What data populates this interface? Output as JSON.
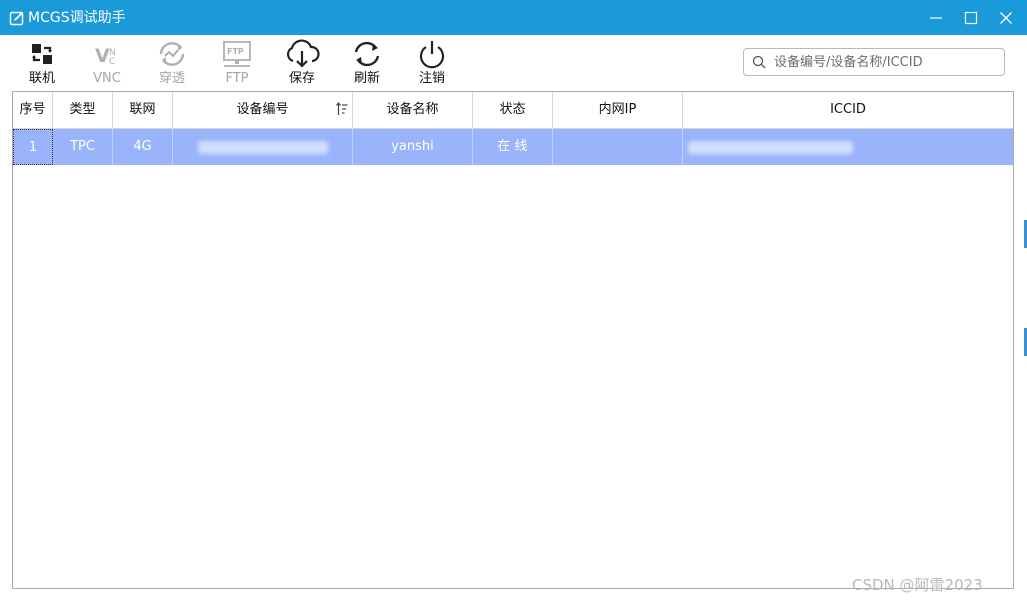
{
  "window": {
    "title": "MCGS调试助手"
  },
  "toolbar": {
    "items": [
      {
        "label": "联机",
        "icon": "link-icon",
        "enabled": true
      },
      {
        "label": "VNC",
        "icon": "vnc-icon",
        "enabled": false
      },
      {
        "label": "穿透",
        "icon": "penetrate-icon",
        "enabled": false
      },
      {
        "label": "FTP",
        "icon": "ftp-icon",
        "enabled": false
      },
      {
        "label": "保存",
        "icon": "cloud-download-icon",
        "enabled": true
      },
      {
        "label": "刷新",
        "icon": "refresh-icon",
        "enabled": true
      },
      {
        "label": "注销",
        "icon": "power-icon",
        "enabled": true
      }
    ]
  },
  "search": {
    "placeholder": "设备编号/设备名称/ICCID",
    "value": ""
  },
  "table": {
    "columns": [
      "序号",
      "类型",
      "联网",
      "设备编号",
      "设备名称",
      "状态",
      "内网IP",
      "ICCID"
    ],
    "rows": [
      {
        "index": "1",
        "type": "TPC",
        "network": "4G",
        "device_id": "",
        "device_name": "yanshi",
        "status": "在 线",
        "lan_ip": "",
        "iccid": ""
      }
    ]
  },
  "watermark": "CSDN @阿雷2023",
  "colors": {
    "titlebar": "#1a9ad8",
    "selected_row": "#9ab4fb",
    "disabled_text": "#a6a6a6"
  }
}
